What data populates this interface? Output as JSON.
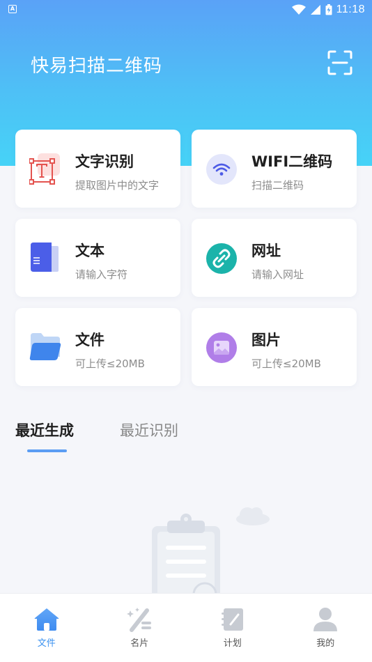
{
  "status_bar": {
    "left_badge": "A",
    "time": "11:18"
  },
  "header": {
    "title": "快易扫描二维码"
  },
  "cards": [
    {
      "title": "文字识别",
      "subtitle": "提取图片中的文字",
      "icon": "text-recognition-icon"
    },
    {
      "title": "WIFI二维码",
      "subtitle": "扫描二维码",
      "icon": "wifi-icon"
    },
    {
      "title": "文本",
      "subtitle": "请输入字符",
      "icon": "book-icon"
    },
    {
      "title": "网址",
      "subtitle": "请输入网址",
      "icon": "link-icon"
    },
    {
      "title": "文件",
      "subtitle": "可上传≤20MB",
      "icon": "folder-icon"
    },
    {
      "title": "图片",
      "subtitle": "可上传≤20MB",
      "icon": "image-icon"
    }
  ],
  "tabs": {
    "recent_generated": "最近生成",
    "recent_recognized": "最近识别"
  },
  "bottom_nav": [
    {
      "label": "文件",
      "icon": "home-icon",
      "active": true
    },
    {
      "label": "名片",
      "icon": "magic-wand-icon",
      "active": false
    },
    {
      "label": "计划",
      "icon": "notebook-icon",
      "active": false
    },
    {
      "label": "我的",
      "icon": "user-icon",
      "active": false
    }
  ],
  "colors": {
    "accent": "#3b92f0",
    "header_top": "#5aa2f7",
    "header_bottom": "#46d3f7"
  }
}
